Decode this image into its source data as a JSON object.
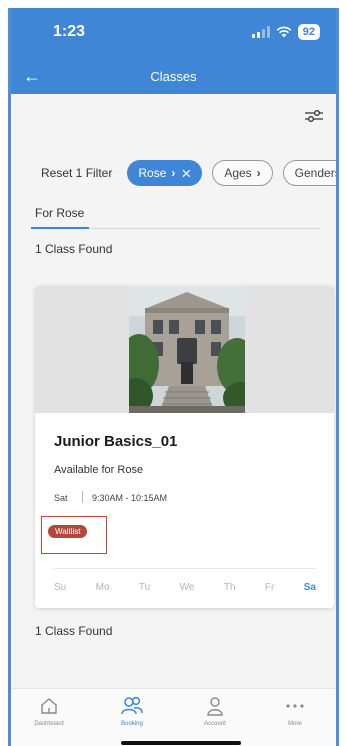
{
  "status_bar": {
    "time": "1:23",
    "battery": "92"
  },
  "header": {
    "title": "Classes"
  },
  "filters": {
    "reset_label": "Reset 1 Filter",
    "active_chip": "Rose",
    "chips": [
      "Ages",
      "Genders"
    ]
  },
  "tab": {
    "label": "For Rose"
  },
  "results": {
    "count_top": "1 Class Found",
    "count_bottom": "1 Class Found"
  },
  "class_card": {
    "title": "Junior Basics_01",
    "availability": "Available for Rose",
    "day": "Sat",
    "time": "9:30AM - 10:15AM",
    "status": "Waitlist",
    "weekdays": [
      "Su",
      "Mo",
      "Tu",
      "We",
      "Th",
      "Fr",
      "Sa"
    ],
    "selected_day": "Sa"
  },
  "bottom_nav": {
    "items": [
      {
        "label": "Dashboard",
        "icon": "home-icon"
      },
      {
        "label": "Booking",
        "icon": "people-icon"
      },
      {
        "label": "Account",
        "icon": "person-icon"
      },
      {
        "label": "More",
        "icon": "more-dots-icon"
      }
    ],
    "active": "Booking"
  },
  "colors": {
    "primary": "#3f87d6",
    "waitlist": "#b8443d",
    "highlight_box": "#c9443c"
  }
}
